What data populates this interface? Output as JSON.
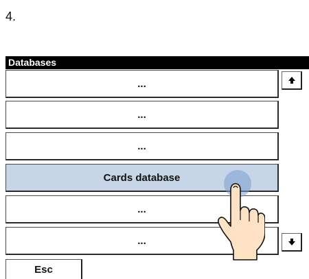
{
  "step_label": "4.",
  "panel": {
    "title": "Databases",
    "rows": [
      "...",
      "...",
      "...",
      "Cards database",
      "...",
      "..."
    ],
    "selected_index": 3
  },
  "buttons": {
    "scroll_up_icon": "arrow-up-icon",
    "scroll_down_icon": "arrow-down-icon",
    "esc_label": "Esc"
  },
  "colors": {
    "header_bg": "#000000",
    "selected_row_bg": "#c6d6e6",
    "touch_indicator": "#78a0d2",
    "hand_fill": "#fde2c4"
  }
}
